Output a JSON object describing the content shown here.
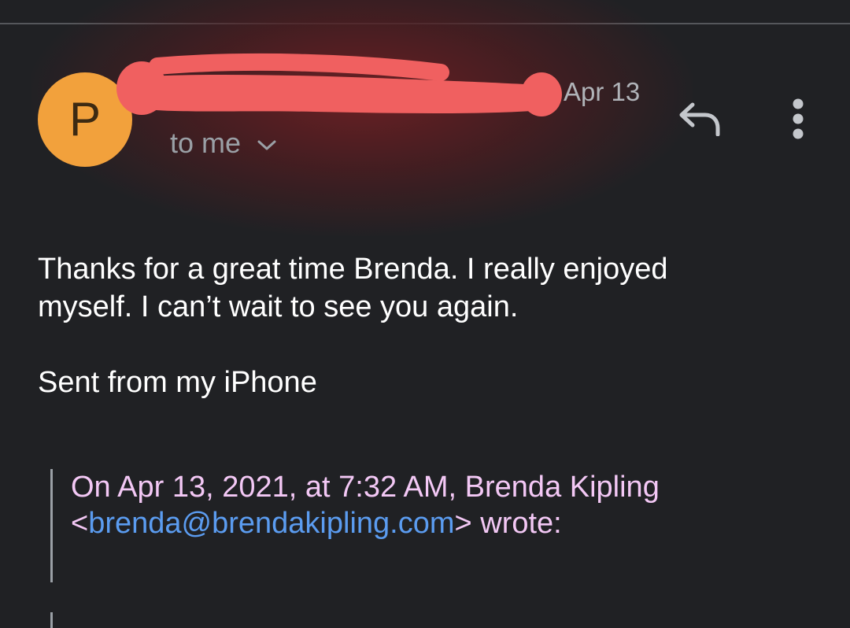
{
  "message": {
    "sender_initial": "P",
    "date": "Apr 13",
    "recipient_label": "to me",
    "body_lines": [
      "Thanks for a great time Brenda. I really enjoyed",
      "myself. I can’t wait to see you again."
    ],
    "signature": "Sent from my iPhone"
  },
  "quote": {
    "intro": "On Apr 13, 2021, at 7:32 AM, Brenda Kipling",
    "open_bracket": "<",
    "email": "brenda@brendakipling.com",
    "close_suffix": "> wrote:"
  },
  "colors": {
    "background": "#202124",
    "avatar": "#f2a13c",
    "redaction": "#f06060",
    "quote_text": "#f3c8f5",
    "link": "#5b9cf0"
  },
  "icons": {
    "reply": "reply-icon",
    "more": "more-vert-icon",
    "expand": "chevron-down-icon"
  }
}
